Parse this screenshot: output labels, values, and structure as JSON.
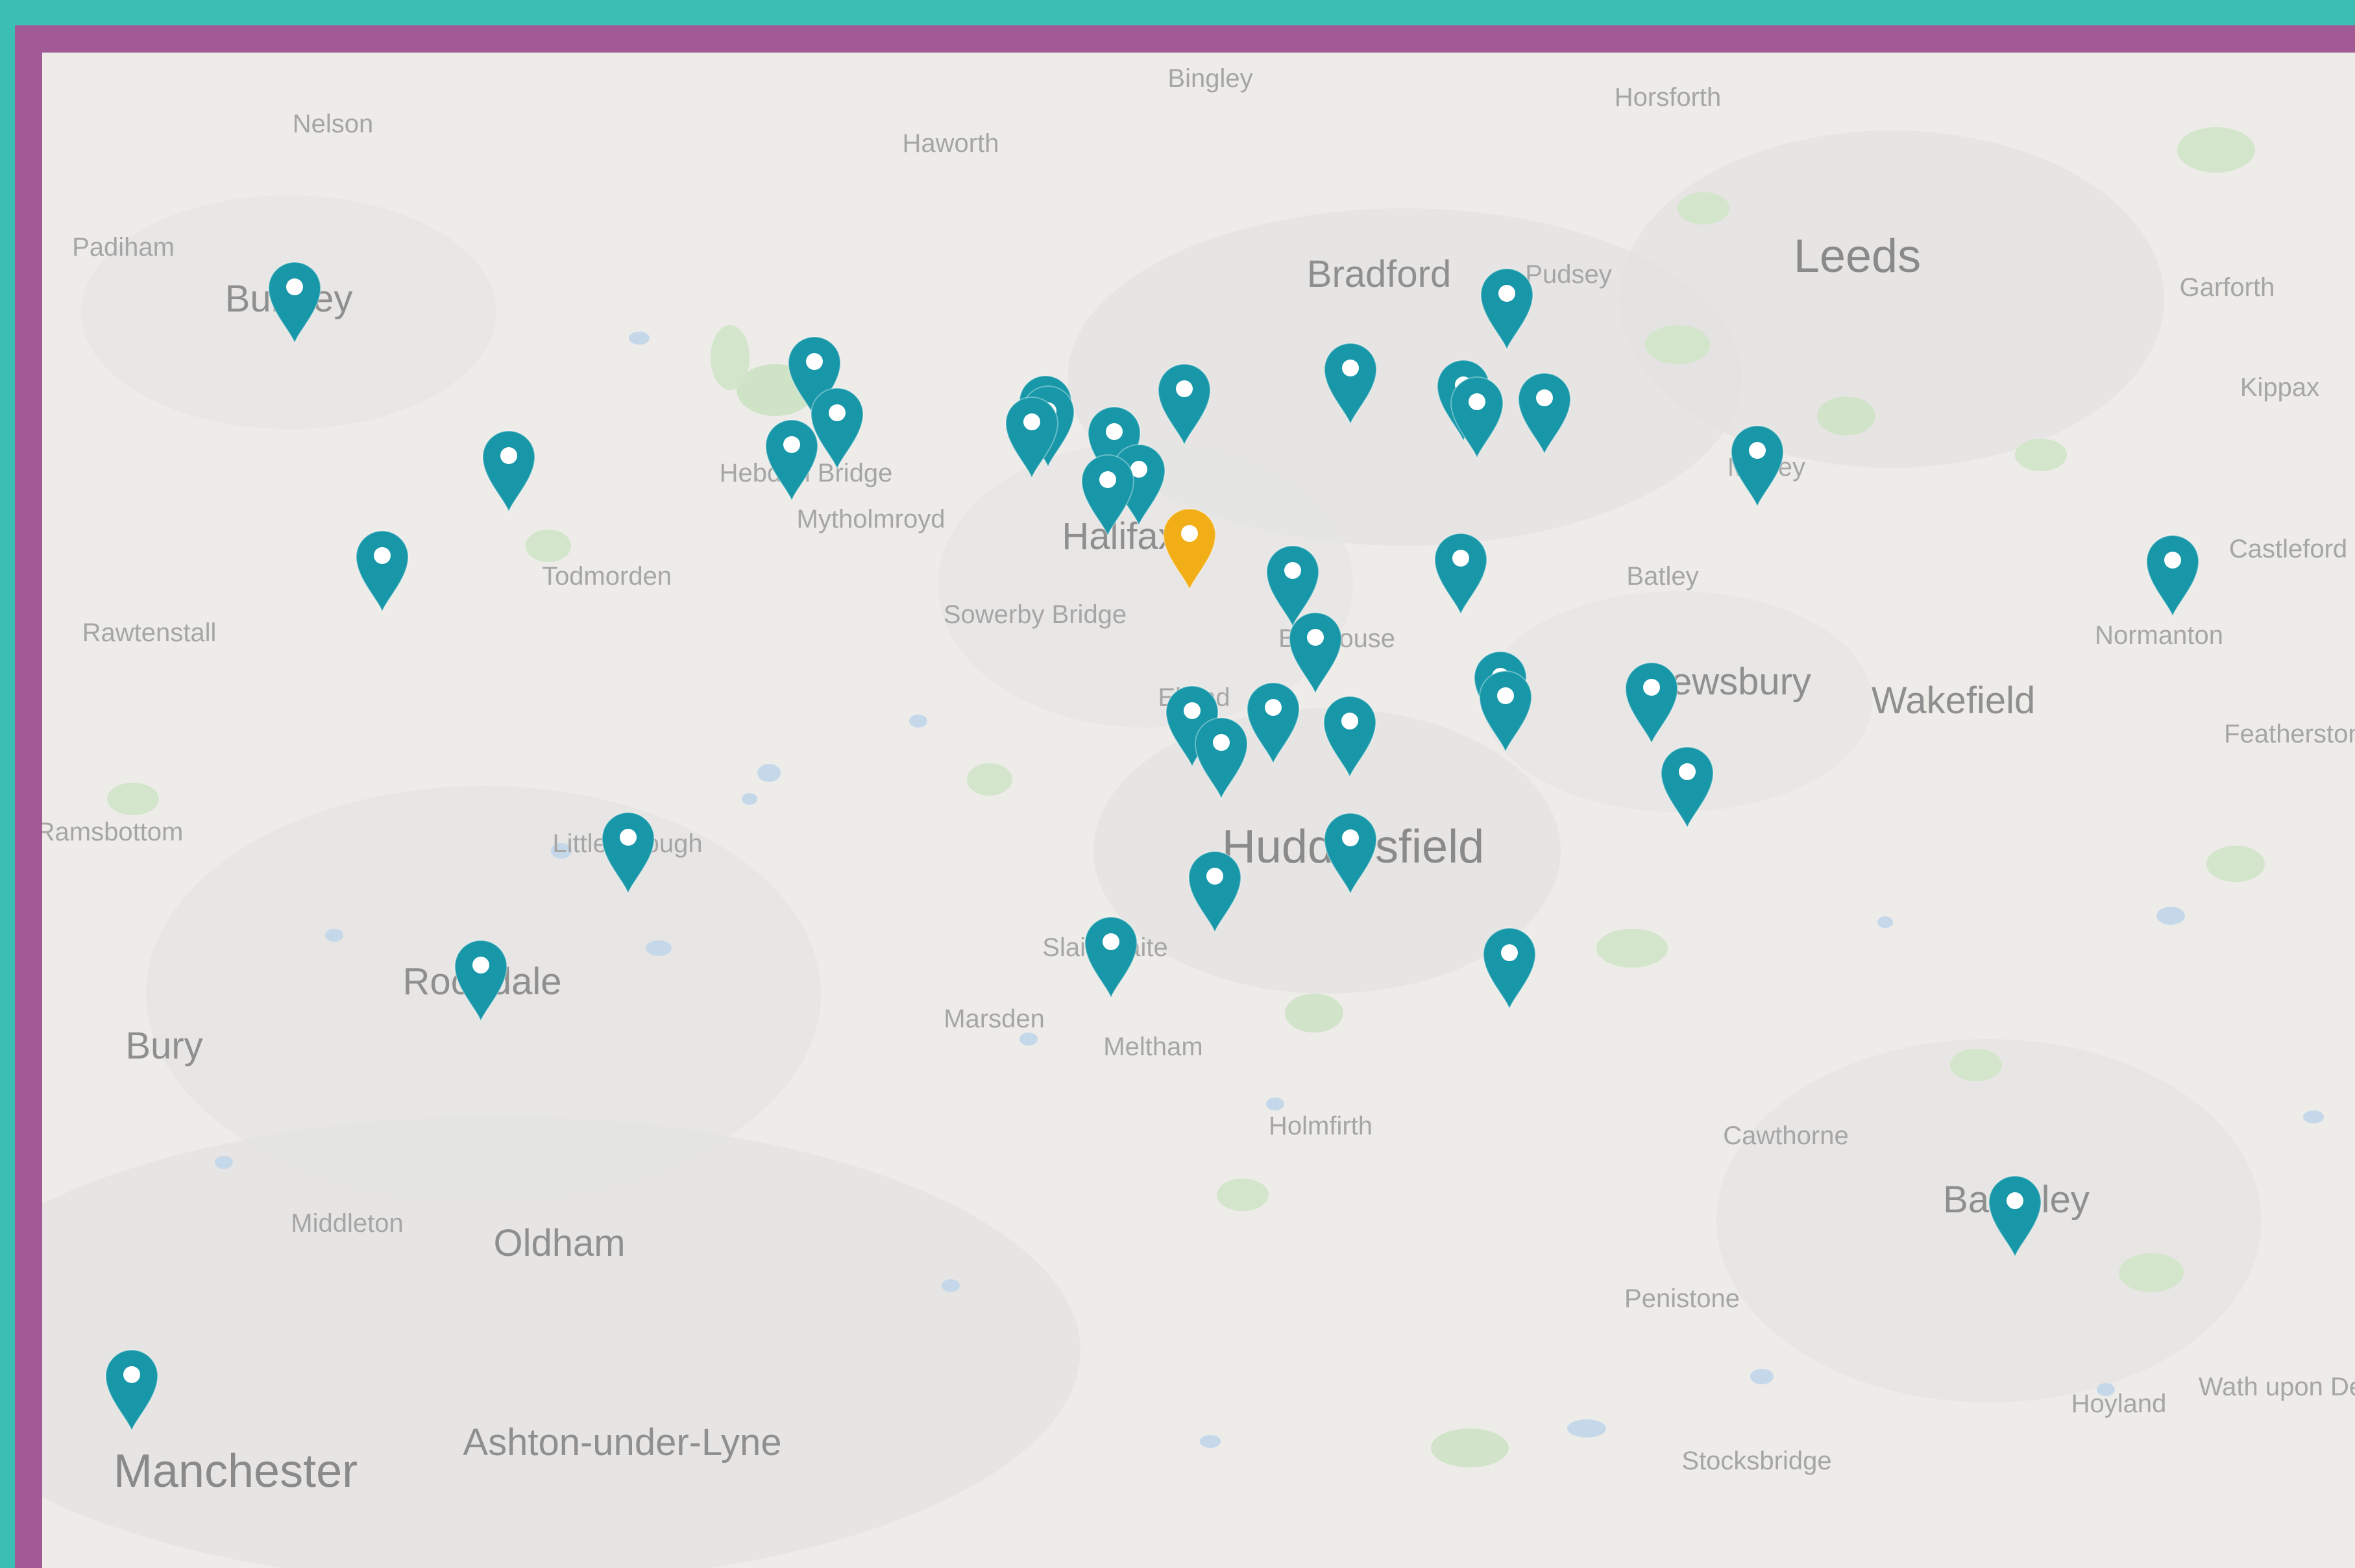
{
  "colors": {
    "outer_bg": "#3cbfb3",
    "frame": "#a25a96",
    "map_bg": "#edece9",
    "marker": "#1797a8",
    "marker_selected": "#f2ae16"
  },
  "map": {
    "labels": [
      {
        "text": "Bingley",
        "size": "sm"
      },
      {
        "text": "Horsforth",
        "size": "sm"
      },
      {
        "text": "Nelson",
        "size": "sm"
      },
      {
        "text": "Haworth",
        "size": "sm"
      },
      {
        "text": "Padiham",
        "size": "sm"
      },
      {
        "text": "Burnley",
        "size": "md"
      },
      {
        "text": "Bradford",
        "size": "md"
      },
      {
        "text": "Pudsey",
        "size": "sm"
      },
      {
        "text": "Leeds",
        "size": "lg"
      },
      {
        "text": "Garforth",
        "size": "sm"
      },
      {
        "text": "Kippax",
        "size": "sm"
      },
      {
        "text": "Hebden Bridge",
        "size": "sm"
      },
      {
        "text": "Mytholmroyd",
        "size": "sm"
      },
      {
        "text": "Halifax",
        "size": "md"
      },
      {
        "text": "Morley",
        "size": "sm"
      },
      {
        "text": "Todmorden",
        "size": "sm"
      },
      {
        "text": "Sowerby Bridge",
        "size": "sm"
      },
      {
        "text": "Batley",
        "size": "sm"
      },
      {
        "text": "Castleford",
        "size": "sm"
      },
      {
        "text": "Rawtenstall",
        "size": "sm"
      },
      {
        "text": "Brighouse",
        "size": "sm"
      },
      {
        "text": "Normanton",
        "size": "sm"
      },
      {
        "text": "Elland",
        "size": "sm"
      },
      {
        "text": "Dewsbury",
        "size": "md"
      },
      {
        "text": "Wakefield",
        "size": "md"
      },
      {
        "text": "Featherstone",
        "size": "sm"
      },
      {
        "text": "Ramsbottom",
        "size": "sm"
      },
      {
        "text": "Littleborough",
        "size": "sm"
      },
      {
        "text": "Huddersfield",
        "size": "lg"
      },
      {
        "text": "Slaithwaite",
        "size": "sm"
      },
      {
        "text": "Rochdale",
        "size": "md"
      },
      {
        "text": "Marsden",
        "size": "sm"
      },
      {
        "text": "Meltham",
        "size": "sm"
      },
      {
        "text": "Bury",
        "size": "md"
      },
      {
        "text": "Holmfirth",
        "size": "sm"
      },
      {
        "text": "Cawthorne",
        "size": "sm"
      },
      {
        "text": "Barnsley",
        "size": "md"
      },
      {
        "text": "Middleton",
        "size": "sm"
      },
      {
        "text": "Oldham",
        "size": "md"
      },
      {
        "text": "Penistone",
        "size": "sm"
      },
      {
        "text": "Wath upon Dearne",
        "size": "sm"
      },
      {
        "text": "Hoyland",
        "size": "sm"
      },
      {
        "text": "Manchester",
        "size": "lg"
      },
      {
        "text": "Ashton-under-Lyne",
        "size": "md"
      },
      {
        "text": "Stocksbridge",
        "size": "sm"
      }
    ],
    "markers": [
      {
        "selected": false
      },
      {
        "selected": false
      },
      {
        "selected": false
      },
      {
        "selected": false
      },
      {
        "selected": false
      },
      {
        "selected": false
      },
      {
        "selected": false
      },
      {
        "selected": false
      },
      {
        "selected": false
      },
      {
        "selected": false
      },
      {
        "selected": false
      },
      {
        "selected": false
      },
      {
        "selected": false
      },
      {
        "selected": false
      },
      {
        "selected": false
      },
      {
        "selected": false
      },
      {
        "selected": false
      },
      {
        "selected": false
      },
      {
        "selected": true
      },
      {
        "selected": false
      },
      {
        "selected": false
      },
      {
        "selected": false
      },
      {
        "selected": false
      },
      {
        "selected": false
      },
      {
        "selected": false
      },
      {
        "selected": false
      },
      {
        "selected": false
      },
      {
        "selected": false
      },
      {
        "selected": false
      },
      {
        "selected": false
      },
      {
        "selected": false
      },
      {
        "selected": false
      },
      {
        "selected": false
      },
      {
        "selected": false
      },
      {
        "selected": false
      },
      {
        "selected": false
      },
      {
        "selected": false
      },
      {
        "selected": false
      },
      {
        "selected": false
      },
      {
        "selected": false
      }
    ]
  }
}
